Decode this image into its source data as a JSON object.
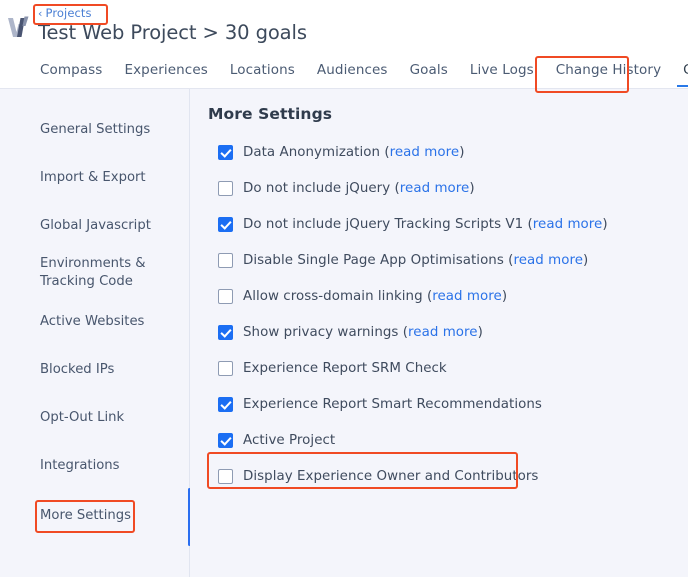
{
  "header": {
    "logo_icon": "wingify-logo-icon",
    "breadcrumb": {
      "chevron": "‹",
      "label": "Projects"
    },
    "title": "Test Web Project > 30 goals",
    "tabs": [
      {
        "label": "Compass",
        "active": false
      },
      {
        "label": "Experiences",
        "active": false
      },
      {
        "label": "Locations",
        "active": false
      },
      {
        "label": "Audiences",
        "active": false
      },
      {
        "label": "Goals",
        "active": false
      },
      {
        "label": "Live Logs",
        "active": false
      },
      {
        "label": "Change History",
        "active": false
      },
      {
        "label": "Configuration",
        "active": true
      }
    ]
  },
  "sidebar": {
    "items": [
      {
        "label": "General Settings",
        "active": false
      },
      {
        "label": "Import & Export",
        "active": false
      },
      {
        "label": "Global Javascript",
        "active": false
      },
      {
        "label": "Environments & Tracking Code",
        "active": false
      },
      {
        "label": "Active Websites",
        "active": false
      },
      {
        "label": "Blocked IPs",
        "active": false
      },
      {
        "label": "Opt-Out Link",
        "active": false
      },
      {
        "label": "Integrations",
        "active": false
      },
      {
        "label": "More Settings",
        "active": true
      }
    ]
  },
  "main": {
    "section_title": "More Settings",
    "read_more_label": "read more",
    "options": [
      {
        "label": "Data Anonymization",
        "checked": true,
        "read_more": true
      },
      {
        "label": "Do not include jQuery",
        "checked": false,
        "read_more": true
      },
      {
        "label": "Do not include jQuery Tracking Scripts V1",
        "checked": true,
        "read_more": true
      },
      {
        "label": "Disable Single Page App Optimisations",
        "checked": false,
        "read_more": true
      },
      {
        "label": "Allow cross-domain linking",
        "checked": false,
        "read_more": true
      },
      {
        "label": "Show privacy warnings",
        "checked": true,
        "read_more": true
      },
      {
        "label": "Experience Report SRM Check",
        "checked": false,
        "read_more": false
      },
      {
        "label": "Experience Report Smart Recommendations",
        "checked": true,
        "read_more": false
      },
      {
        "label": "Active Project",
        "checked": true,
        "read_more": false
      },
      {
        "label": "Display Experience Owner and Contributors",
        "checked": false,
        "read_more": false
      }
    ]
  },
  "colors": {
    "accent_blue": "#2a6ef0",
    "checkbox_blue": "#1b6ef3",
    "link_blue": "#2a72e8",
    "highlight_red": "#f04a24",
    "background": "#f4f5fb",
    "header_bg": "#ffffff",
    "text": "#3f4b5e"
  }
}
